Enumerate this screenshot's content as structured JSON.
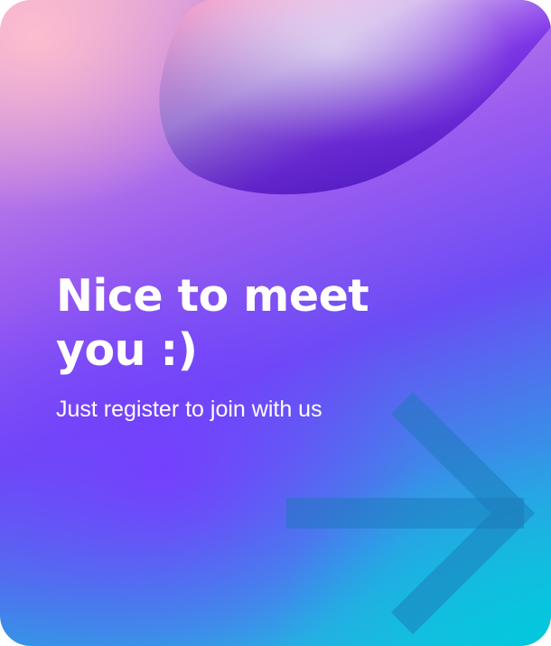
{
  "card": {
    "title": "Nice to meet you :)",
    "subtitle": "Just register to join with us"
  },
  "decor": {
    "blob_icon": "abstract-blob",
    "arrow_icon": "arrow-right"
  },
  "colors": {
    "pink": "#f4b6c8",
    "violet": "#7b3cf5",
    "blue": "#3a7be8",
    "cyan": "#12c2e0",
    "text": "#ffffff"
  }
}
